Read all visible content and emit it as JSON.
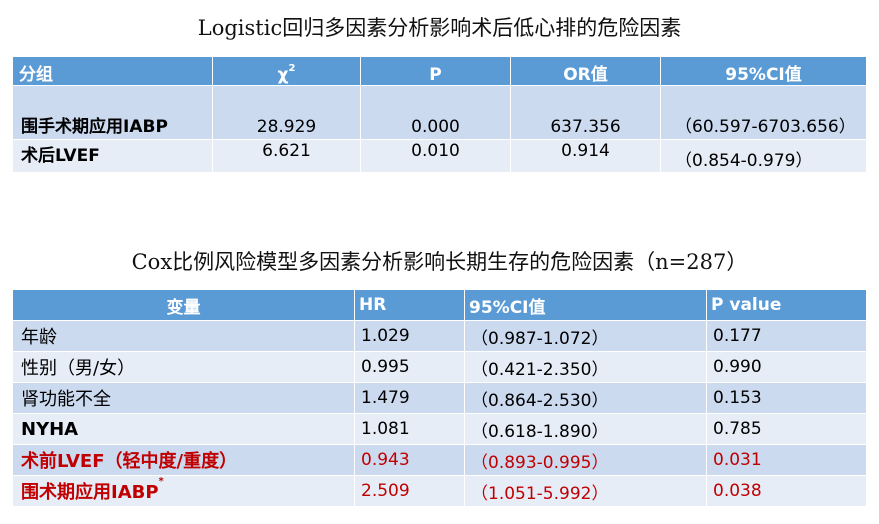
{
  "table1": {
    "title": "Logistic回归多因素分析影响术后低心排的危险因素",
    "headers": [
      "分组",
      "χ",
      "2",
      "P",
      "OR值",
      "95%CI值"
    ],
    "rows": [
      [
        "围手术期应用IABP",
        "28.929",
        "0.000",
        "637.356",
        "（60.597-6703.656）"
      ],
      [
        "术后LVEF",
        "6.621",
        "0.010",
        "0.914",
        "（0.854-0.979）"
      ]
    ]
  },
  "table2": {
    "title": "Cox比例风险模型多因素分析影响长期生存的危险因素（n=287）",
    "headers": [
      "变量",
      "HR",
      "95%CI值",
      "P value"
    ],
    "rows": [
      [
        "年龄",
        "1.029",
        "（0.987-1.072）",
        "0.177"
      ],
      [
        "性别（男/女）",
        "0.995",
        "（0.421-2.350）",
        "0.990"
      ],
      [
        "肾功能不全",
        "1.479",
        "（0.864-2.530）",
        "0.153"
      ],
      [
        "NYHA",
        "1.081",
        "（0.618-1.890）",
        "0.785"
      ],
      [
        "术前LVEF（轻中度/重度）",
        "0.943",
        "（0.893-0.995）",
        "0.031"
      ],
      [
        "围术期应用IABP",
        "2.509",
        "（1.051-5.992）",
        "0.038"
      ]
    ],
    "last_row_marker": "*",
    "highlight_color": "#c00000"
  }
}
